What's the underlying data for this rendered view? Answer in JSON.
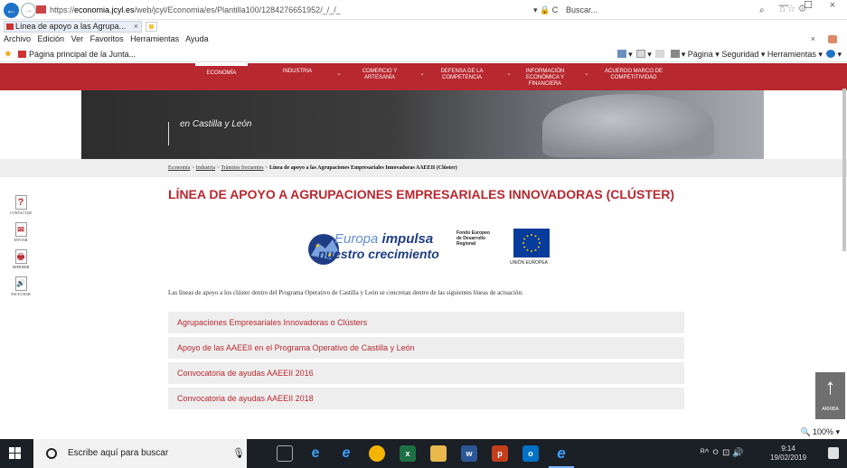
{
  "browser": {
    "url_prefix": "https://",
    "url_host": "economia.jcyl.es",
    "url_path": "/web/jcyl/Economia/es/Plantilla100/1284276651952/_/_/_",
    "addr_controls": "▾ 🔒 C",
    "search_placeholder": "Buscar...",
    "tab_title": "Línea de apoyo a las Agrupa...",
    "tab_close": "×",
    "menu": [
      "Archivo",
      "Edición",
      "Ver",
      "Favoritos",
      "Herramientas",
      "Ayuda"
    ],
    "favorite_link": "Página principal de la Junta...",
    "commandbar": {
      "page": "Página ▾",
      "security": "Seguridad ▾",
      "tools": "Herramientas ▾"
    },
    "zoom": "100%",
    "window_controls": {
      "minimize": "—",
      "maximize": "☐",
      "close": "×"
    }
  },
  "site": {
    "nav": [
      {
        "label": "ECONOMÍA",
        "active": true
      },
      {
        "label": "INDUSTRIA",
        "active": false
      },
      {
        "label": "COMERCIO Y ARTESANÍA",
        "active": false
      },
      {
        "label": "DEFENSA DE LA COMPETENCIA",
        "active": false
      },
      {
        "label": "INFORMACIÓN ECONÓMICA Y FINANCIERA",
        "active": false
      },
      {
        "label": "ACUERDO MARCO DE COMPETITIVIDAD",
        "active": false
      }
    ],
    "banner_subtitle": "en Castilla y León",
    "breadcrumb": {
      "items": [
        "Economía",
        "Industria",
        "Trámites frecuentes"
      ],
      "current": "Línea de apoyo a las Agrupaciones Empresariales Innovadoras AAEEII (Clúster)"
    },
    "side_tools": [
      {
        "label": "CONTACTAR",
        "glyph": "?"
      },
      {
        "label": "ENVIAR",
        "glyph": "✉"
      },
      {
        "label": "IMPRIMIR",
        "glyph": "🖶"
      },
      {
        "label": "ESCUCHAR",
        "glyph": "🔊"
      }
    ],
    "title": "LÍNEA DE APOYO A AGRUPACIONES EMPRESARIALES INNOVADORAS (CLÚSTER)",
    "logo": {
      "line1_a": "Europa ",
      "line1_b": "impulsa",
      "line2": "nuestro crecimiento",
      "fund": "Fondo Europeo\nde Desarrollo\nRegional",
      "eu_label": "UNIÓN EUROPEA"
    },
    "intro": "Las líneas de apoyo a  los clúster dentro del Programa Operativo de Castilla y León se concretan dentro de las siguientes líneas de actuación:",
    "lines": [
      "Agrupaciones Empresariales Innovadoras o Clústers",
      "Apoyo de las AAEEII en el Programa Operativo de Castilla y León",
      "Convocatoria de ayudas AAEEII 2016",
      "Convocatoria de ayudas AAEEII 2018"
    ],
    "back_to_top": "ARRIBA"
  },
  "taskbar": {
    "search_placeholder": "Escribe aquí para buscar",
    "clock_time": "9:14",
    "clock_date": "19/02/2019",
    "tray": "ᴿ^  ㅇ ⊡ 🔊"
  },
  "colors": {
    "brand_red": "#b8282f",
    "eu_blue": "#073b9c",
    "taskbar": "#1b1f26"
  }
}
